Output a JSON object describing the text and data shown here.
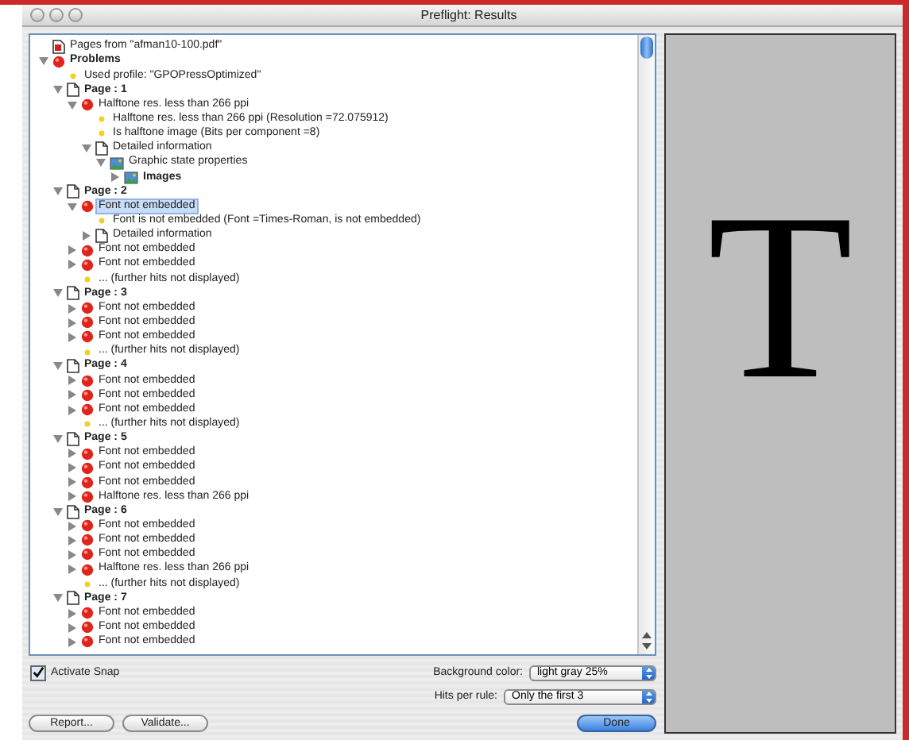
{
  "window": {
    "title": "Preflight: Results"
  },
  "tree": [
    {
      "label": "Pages from \"afman10-100.pdf\"",
      "kind": "file",
      "selected": false
    },
    {
      "label": "Problems",
      "kind": "group",
      "selected": false,
      "expanded": true,
      "children": [
        {
          "label": "Used profile: \"GPOPressOptimized\"",
          "kind": "info",
          "selected": false
        },
        {
          "label": "Page : 1",
          "kind": "page",
          "selected": false,
          "expanded": true,
          "children": [
            {
              "label": "Halftone res. less than 266 ppi",
              "kind": "error",
              "selected": false,
              "expanded": true,
              "children": [
                {
                  "label": "Halftone res. less than 266 ppi (Resolution =72.075912)",
                  "kind": "info",
                  "selected": false
                },
                {
                  "label": "Is halftone image (Bits per component =8)",
                  "kind": "info",
                  "selected": false
                },
                {
                  "label": "Detailed information",
                  "kind": "doc",
                  "selected": false,
                  "expanded": true,
                  "children": [
                    {
                      "label": "Graphic state properties",
                      "kind": "graphic",
                      "selected": false,
                      "expanded": true,
                      "children": [
                        {
                          "label": "Images",
                          "kind": "images",
                          "selected": false,
                          "expanded": false
                        }
                      ]
                    }
                  ]
                }
              ]
            }
          ]
        },
        {
          "label": "Page : 2",
          "kind": "page",
          "selected": false,
          "expanded": true,
          "children": [
            {
              "label": "Font not embedded",
              "kind": "error",
              "selected": true,
              "expanded": true,
              "children": [
                {
                  "label": "Font is not embedded (Font =Times-Roman, is not embedded)",
                  "kind": "info",
                  "selected": false
                },
                {
                  "label": "Detailed information",
                  "kind": "doc",
                  "selected": false,
                  "expanded": false
                }
              ]
            },
            {
              "label": "Font not embedded",
              "kind": "error",
              "selected": false,
              "expanded": false
            },
            {
              "label": "Font not embedded",
              "kind": "error",
              "selected": false,
              "expanded": false
            },
            {
              "label": "... (further hits not displayed)",
              "kind": "info",
              "selected": false
            }
          ]
        },
        {
          "label": "Page : 3",
          "kind": "page",
          "selected": false,
          "expanded": true,
          "children": [
            {
              "label": "Font not embedded",
              "kind": "error",
              "selected": false,
              "expanded": false
            },
            {
              "label": "Font not embedded",
              "kind": "error",
              "selected": false,
              "expanded": false
            },
            {
              "label": "Font not embedded",
              "kind": "error",
              "selected": false,
              "expanded": false
            },
            {
              "label": "... (further hits not displayed)",
              "kind": "info",
              "selected": false
            }
          ]
        },
        {
          "label": "Page : 4",
          "kind": "page",
          "selected": false,
          "expanded": true,
          "children": [
            {
              "label": "Font not embedded",
              "kind": "error",
              "selected": false,
              "expanded": false
            },
            {
              "label": "Font not embedded",
              "kind": "error",
              "selected": false,
              "expanded": false
            },
            {
              "label": "Font not embedded",
              "kind": "error",
              "selected": false,
              "expanded": false
            },
            {
              "label": "... (further hits not displayed)",
              "kind": "info",
              "selected": false
            }
          ]
        },
        {
          "label": "Page : 5",
          "kind": "page",
          "selected": false,
          "expanded": true,
          "children": [
            {
              "label": "Font not embedded",
              "kind": "error",
              "selected": false,
              "expanded": false
            },
            {
              "label": "Font not embedded",
              "kind": "error",
              "selected": false,
              "expanded": false
            },
            {
              "label": "Font not embedded",
              "kind": "error",
              "selected": false,
              "expanded": false
            },
            {
              "label": "Halftone res. less than 266 ppi",
              "kind": "error",
              "selected": false,
              "expanded": false
            }
          ]
        },
        {
          "label": "Page : 6",
          "kind": "page",
          "selected": false,
          "expanded": true,
          "children": [
            {
              "label": "Font not embedded",
              "kind": "error",
              "selected": false,
              "expanded": false
            },
            {
              "label": "Font not embedded",
              "kind": "error",
              "selected": false,
              "expanded": false
            },
            {
              "label": "Font not embedded",
              "kind": "error",
              "selected": false,
              "expanded": false
            },
            {
              "label": "Halftone res. less than 266 ppi",
              "kind": "error",
              "selected": false,
              "expanded": false
            },
            {
              "label": "... (further hits not displayed)",
              "kind": "info",
              "selected": false
            }
          ]
        },
        {
          "label": "Page : 7",
          "kind": "page",
          "selected": false,
          "expanded": true,
          "children": [
            {
              "label": "Font not embedded",
              "kind": "error",
              "selected": false,
              "expanded": false
            },
            {
              "label": "Font not embedded",
              "kind": "error",
              "selected": false,
              "expanded": false
            },
            {
              "label": "Font not embedded",
              "kind": "error",
              "selected": false,
              "expanded": false
            }
          ]
        }
      ]
    }
  ],
  "activate_snap": {
    "label": "Activate Snap",
    "checked": true
  },
  "background_color": {
    "label": "Background color:",
    "value": "light gray 25%"
  },
  "hits_per_rule": {
    "label": "Hits per rule:",
    "value": "Only the first 3"
  },
  "preview": {
    "glyph": "T"
  },
  "buttons": [
    {
      "label": "Report...",
      "kind": "plain"
    },
    {
      "label": "Validate...",
      "kind": "plain"
    },
    {
      "label": "Done",
      "kind": "default"
    }
  ]
}
